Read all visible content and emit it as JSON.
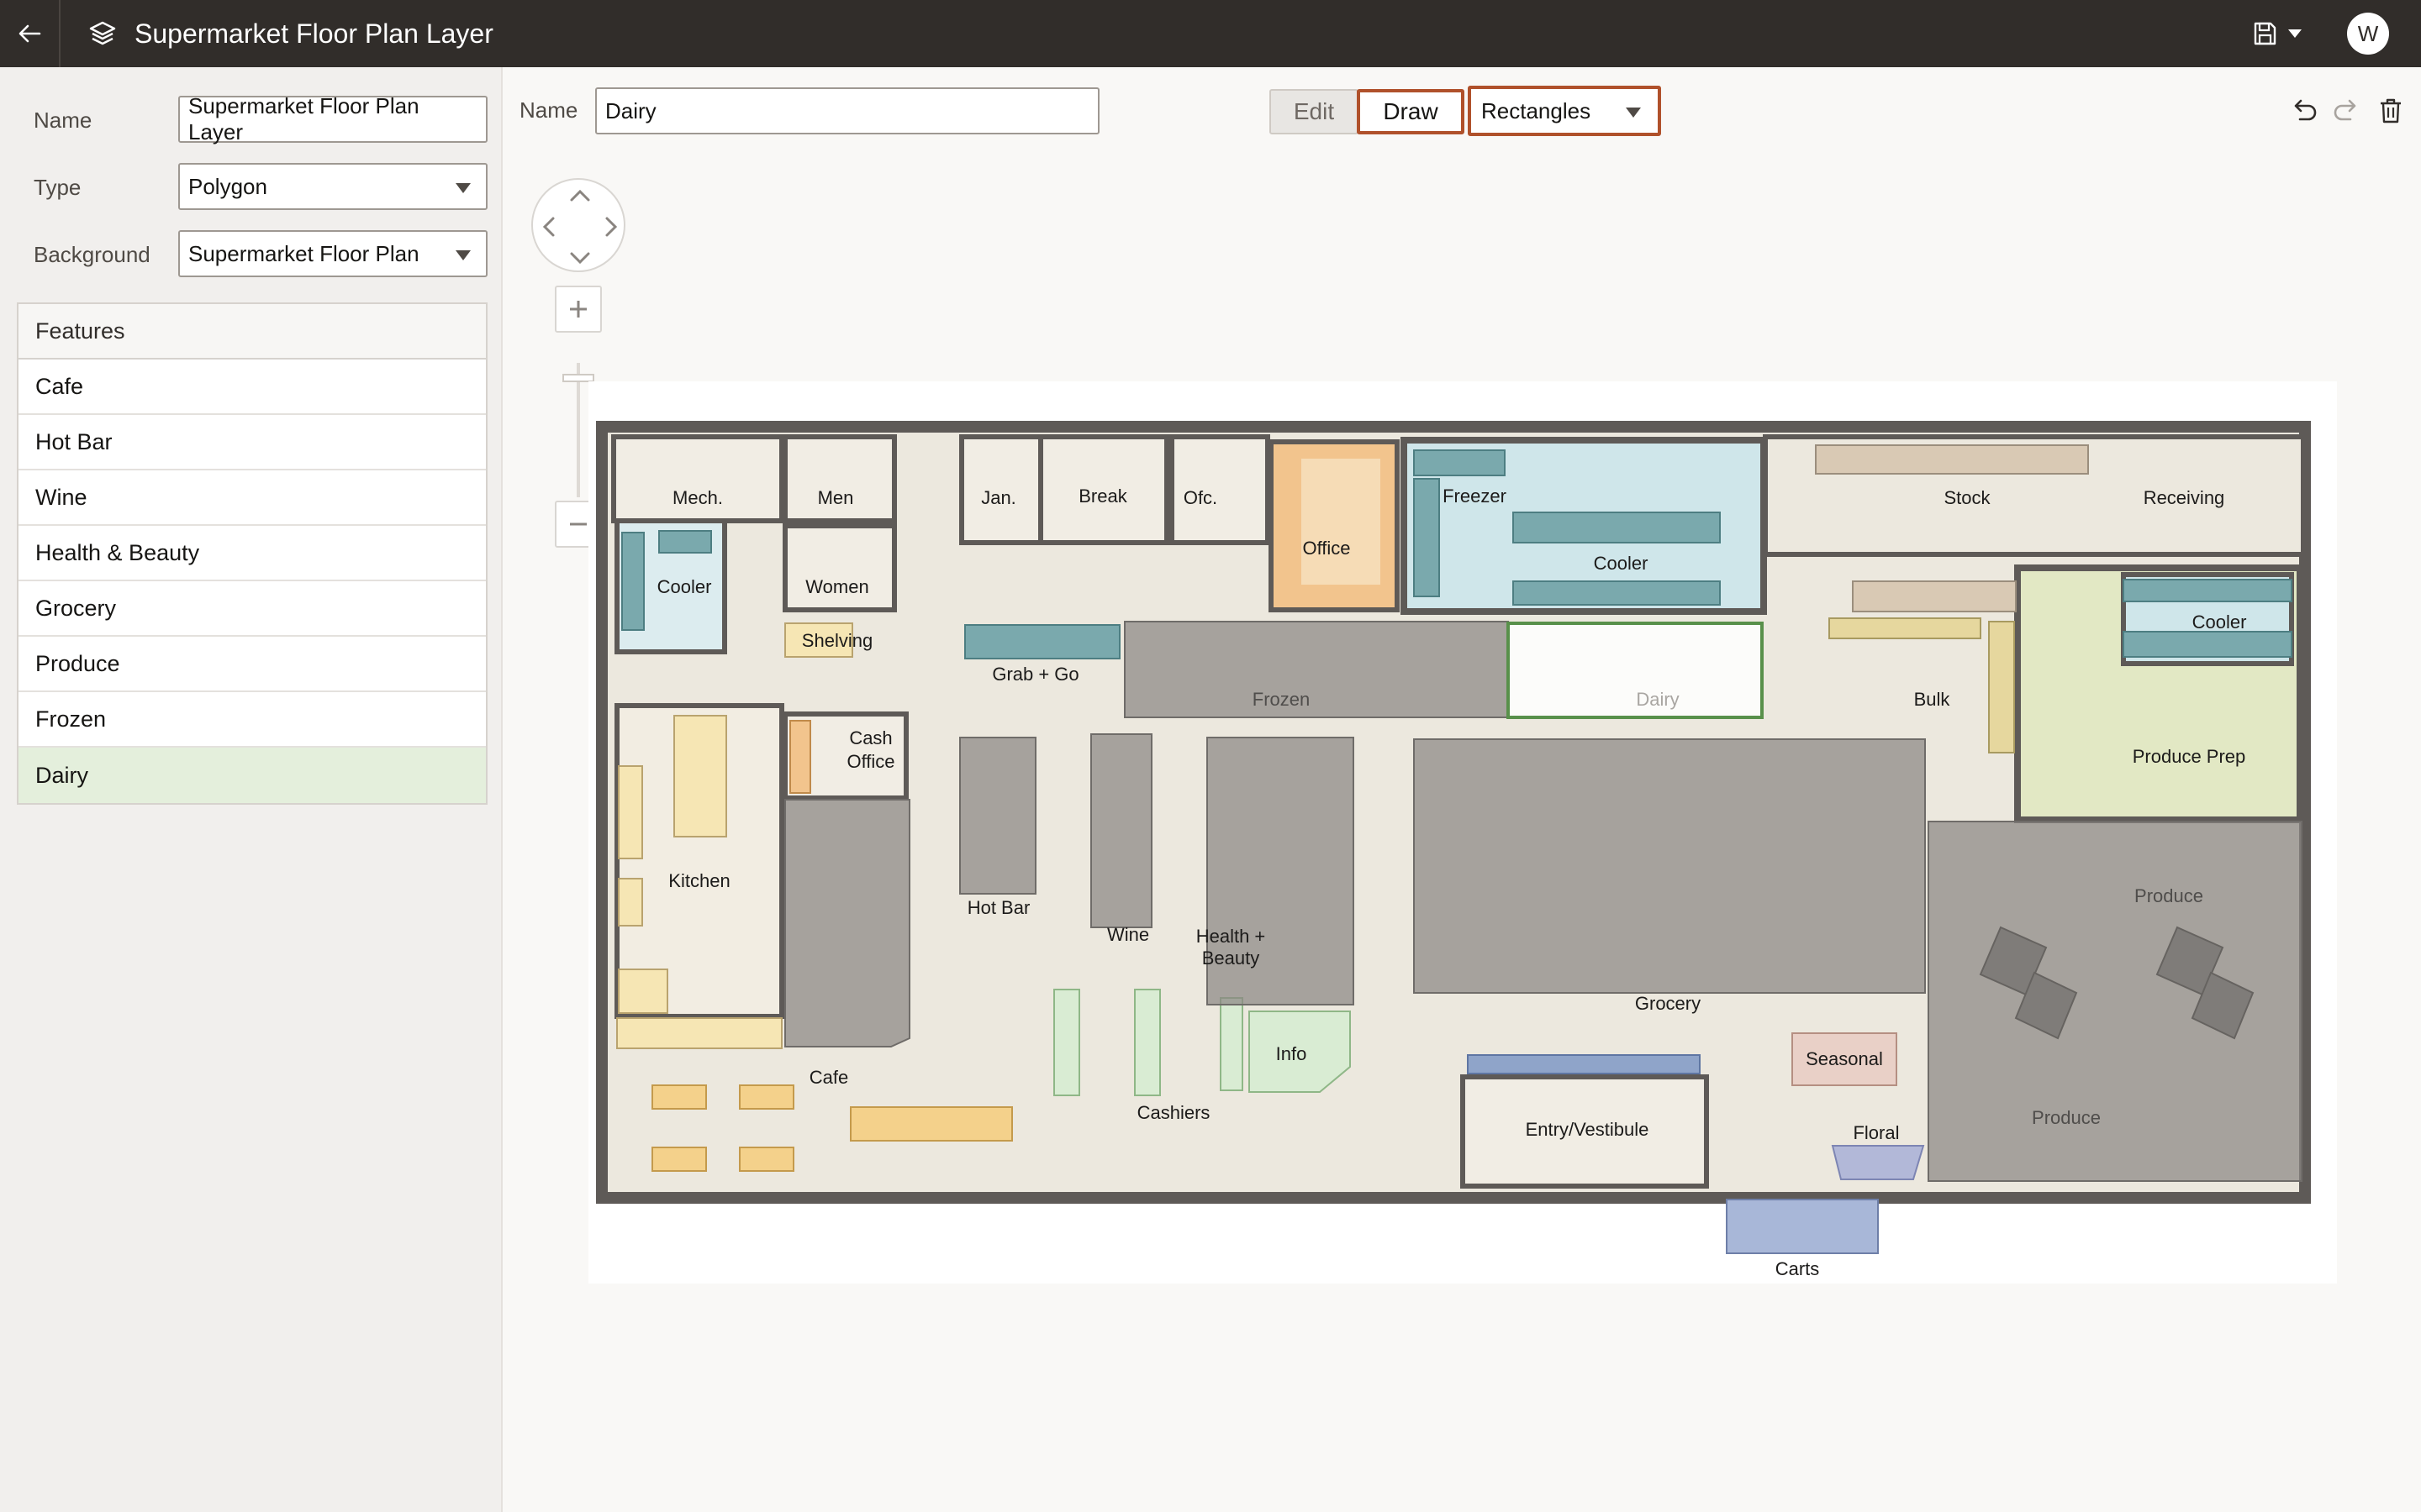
{
  "app": {
    "title": "Supermarket Floor Plan Layer",
    "user_initial": "W"
  },
  "properties": {
    "name_label": "Name",
    "name_value": "Supermarket Floor Plan Layer",
    "type_label": "Type",
    "type_value": "Polygon",
    "background_label": "Background",
    "background_value": "Supermarket Floor Plan"
  },
  "features": {
    "header": "Features",
    "items": [
      "Cafe",
      "Hot Bar",
      "Wine",
      "Health & Beauty",
      "Grocery",
      "Produce",
      "Frozen",
      "Dairy"
    ],
    "selected": "Dairy"
  },
  "toolbar": {
    "name_label": "Name",
    "name_value": "Dairy",
    "edit_label": "Edit",
    "draw_label": "Draw",
    "shape_value": "Rectangles"
  },
  "floorplan": {
    "rooms": {
      "mech": "Mech.",
      "men": "Men",
      "jan": "Jan.",
      "break": "Break",
      "ofc": "Ofc.",
      "office": "Office",
      "freezer": "Freezer",
      "cooler_top": "Cooler",
      "stock": "Stock",
      "receiving": "Receiving",
      "cooler_left": "Cooler",
      "women": "Women",
      "shelving": "Shelving",
      "grab_go": "Grab + Go",
      "cooler_right": "Cooler",
      "bulk": "Bulk",
      "cash_office_1": "Cash",
      "cash_office_2": "Office",
      "produce_prep": "Produce Prep",
      "kitchen": "Kitchen",
      "hot_bar": "Hot Bar",
      "wine": "Wine",
      "health_beauty_1": "Health +",
      "health_beauty_2": "Beauty",
      "grocery": "Grocery",
      "info": "Info",
      "seasonal": "Seasonal",
      "cafe": "Cafe",
      "cashiers": "Cashiers",
      "entry": "Entry/Vestibule",
      "floral": "Floral",
      "carts": "Carts"
    },
    "areas": {
      "frozen": "Frozen",
      "dairy": "Dairy",
      "produce_top": "Produce",
      "produce_bottom": "Produce"
    },
    "colors": {
      "wall": "#5e5a57",
      "floor": "#ece8de",
      "area_fill": "#8a8784",
      "area_selected": "#58904a",
      "cold": "#cfe6ea",
      "case": "#7aa9ad",
      "wood": "#f2c48d",
      "kitchen": "#f6e6b4",
      "produce_prep": "#e2e8c4",
      "seasonal": "#e9d0c7",
      "checkout": "#d9ecd3",
      "entry_case": "#8fa4c9"
    }
  }
}
